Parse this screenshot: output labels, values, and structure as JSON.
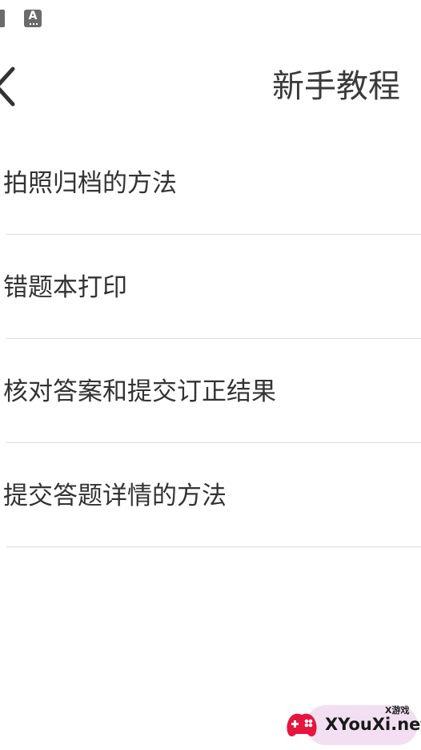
{
  "status_bar": {
    "icons": [
      "notification-icon",
      "accessibility-a-icon"
    ],
    "a_icon_glyph": "A"
  },
  "header": {
    "back_icon": "chevron-left-icon",
    "title": "新手教程"
  },
  "tutorial_list": {
    "items": [
      {
        "label": "拍照归档的方法"
      },
      {
        "label": "错题本打印"
      },
      {
        "label": "核对答案和提交订正结果"
      },
      {
        "label": "提交答题详情的方法"
      }
    ]
  },
  "watermark": {
    "logo_icon": "gamepad-logo-icon",
    "small_text": "X游戏",
    "big_text": "XYouXi.net"
  },
  "colors": {
    "background": "#ffffff",
    "text": "#333333",
    "divider": "#dcdcdc",
    "icon_gray": "#6b6b6b",
    "watermark_red": "#e6163f"
  }
}
